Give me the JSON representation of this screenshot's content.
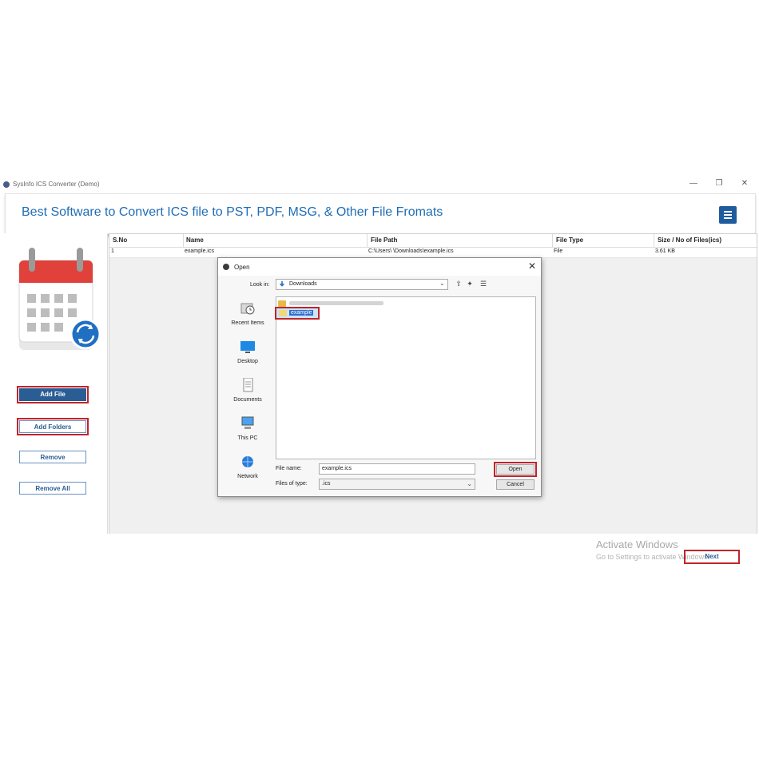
{
  "window": {
    "title": "SysInfo ICS Converter (Demo)",
    "controls": {
      "minimize": "—",
      "restore": "❐",
      "close": "✕"
    }
  },
  "banner": {
    "heading": "Best Software to Convert ICS file to PST, PDF, MSG, & Other File Fromats",
    "accent_color": "#1f6db5"
  },
  "sidebar": {
    "buttons": {
      "add_file": "Add File",
      "add_folders": "Add Folders",
      "remove": "Remove",
      "remove_all": "Remove All"
    }
  },
  "table": {
    "columns": [
      "S.No",
      "Name",
      "File Path",
      "File Type",
      "Size / No of Files(ics)"
    ],
    "rows": [
      {
        "sno": "1",
        "name": "example.ics",
        "path": "C:\\Users\\        \\Downloads\\example.ics",
        "type": "File",
        "size": "3.61 KB"
      }
    ]
  },
  "watermark": {
    "line1": "Activate Windows",
    "line2": "Go to Settings to activate Windows."
  },
  "next_button": "Next",
  "dialog": {
    "title": "Open",
    "look_in_label": "Look in:",
    "look_in_value": "Downloads",
    "places": [
      "Recent Items",
      "Desktop",
      "Documents",
      "This PC",
      "Network"
    ],
    "files": [
      {
        "name": "example",
        "selected": true
      }
    ],
    "file_name_label": "File name:",
    "file_name_value": "example.ics",
    "files_of_type_label": "Files of type:",
    "files_of_type_value": ".ics",
    "open_button": "Open",
    "cancel_button": "Cancel"
  },
  "colors": {
    "primary_button": "#2a5d93",
    "highlight_outline": "#c0242b"
  }
}
